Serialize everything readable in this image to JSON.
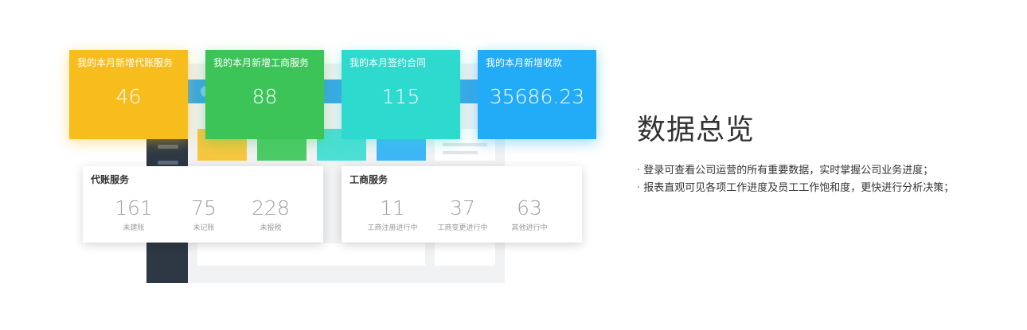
{
  "tiles": [
    {
      "label": "我的本月新增代账服务",
      "value": "46"
    },
    {
      "label": "我的本月新增工商服务",
      "value": "88"
    },
    {
      "label": "我的本月签约合同",
      "value": "115"
    },
    {
      "label": "我的本月新增收款",
      "value": "35686.23"
    }
  ],
  "accounting_card": {
    "title": "代账服务",
    "stats": [
      {
        "value": "161",
        "label": "未建账"
      },
      {
        "value": "75",
        "label": "未记账"
      },
      {
        "value": "228",
        "label": "未报税"
      }
    ]
  },
  "business_card": {
    "title": "工商服务",
    "stats": [
      {
        "value": "11",
        "label": "工商注册进行中"
      },
      {
        "value": "37",
        "label": "工商变更进行中"
      },
      {
        "value": "63",
        "label": "其他进行中"
      }
    ]
  },
  "feature": {
    "headline": "数据总览",
    "bullets": [
      "登录可查看公司运营的所有重要数据，实时掌握公司业务进度；",
      "报表直观可见各项工作进度及员工工作饱和度，更快进行分析决策；"
    ]
  },
  "colors": {
    "tile_yellow": "#f7bd1d",
    "tile_green": "#3cc458",
    "tile_teal": "#2ed9cd",
    "tile_blue": "#22acf7"
  }
}
